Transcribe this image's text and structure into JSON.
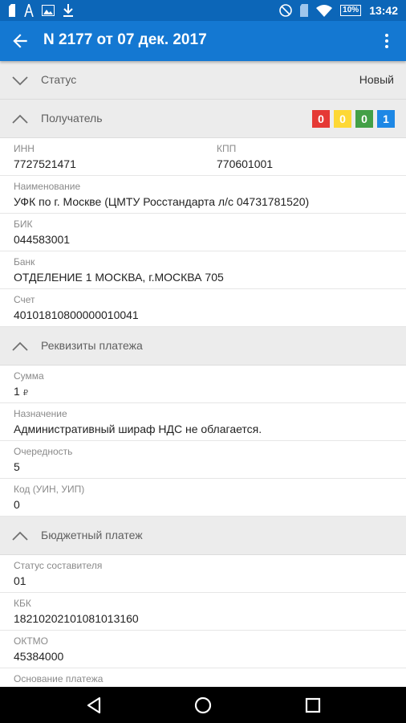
{
  "status_bar": {
    "time": "13:42",
    "battery": "10%",
    "icons": [
      "sim-icon",
      "a-icon",
      "image-icon",
      "download-icon",
      "dnd-icon",
      "sdcard-icon",
      "wifi-icon"
    ]
  },
  "app_bar": {
    "title": "N 2177 от 07 дек. 2017",
    "back_icon": "arrow-back-icon",
    "menu_icon": "more-vert-icon"
  },
  "status_section": {
    "title": "Статус",
    "value": "Новый"
  },
  "recipient_section": {
    "title": "Получатель",
    "badges": [
      {
        "text": "0",
        "color": "#e53935"
      },
      {
        "text": "0",
        "color": "#fdd835"
      },
      {
        "text": "0",
        "color": "#43a047"
      },
      {
        "text": "1",
        "color": "#1e88e5"
      }
    ],
    "inn": {
      "label": "ИНН",
      "value": "7727521471"
    },
    "kpp": {
      "label": "КПП",
      "value": "770601001"
    },
    "name": {
      "label": "Наименование",
      "value": "УФК по г. Москве (ЦМТУ Росстандарта л/с 04731781520)"
    },
    "bik": {
      "label": "БИК",
      "value": "044583001"
    },
    "bank": {
      "label": "Банк",
      "value": "ОТДЕЛЕНИЕ 1 МОСКВА, г.МОСКВА 705"
    },
    "account": {
      "label": "Счет",
      "value": "40101810800000010041"
    }
  },
  "payment_section": {
    "title": "Реквизиты платежа",
    "sum": {
      "label": "Сумма",
      "value": "1",
      "currency": "₽"
    },
    "purpose": {
      "label": "Назначение",
      "value": "Административный шираф НДС не облагается."
    },
    "priority": {
      "label": "Очередность",
      "value": "5"
    },
    "code": {
      "label": "Код (УИН, УИП)",
      "value": "0"
    }
  },
  "budget_section": {
    "title": "Бюджетный платеж",
    "composer_status": {
      "label": "Статус составителя",
      "value": "01"
    },
    "kbk": {
      "label": "КБК",
      "value": "18210202101081013160"
    },
    "oktmo": {
      "label": "ОКТМО",
      "value": "45384000"
    },
    "basis": {
      "label": "Основание платежа"
    }
  },
  "nav_bar": {
    "icons": [
      "back-triangle-icon",
      "home-circle-icon",
      "recents-square-icon"
    ]
  }
}
